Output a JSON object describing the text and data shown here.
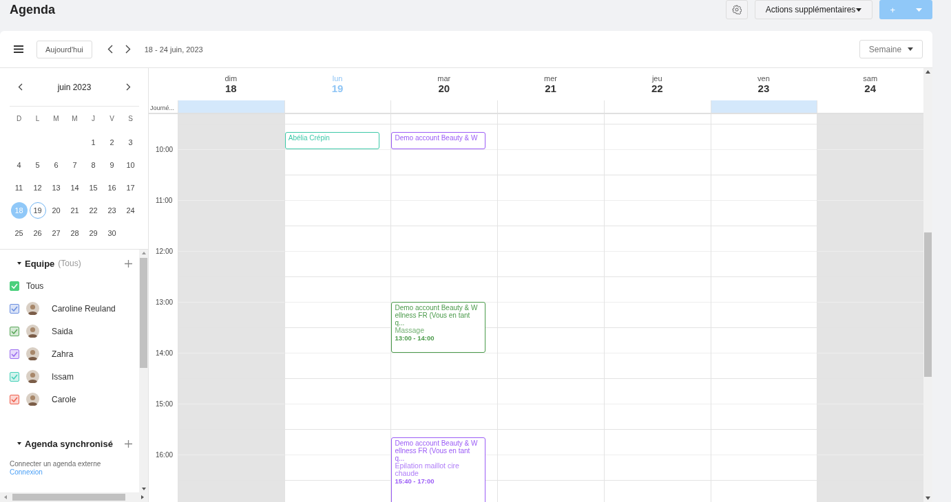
{
  "page_title": "Agenda",
  "header_actions": {
    "more_actions": "Actions supplémentaires",
    "add": "+"
  },
  "toolbar": {
    "today": "Aujourd'hui",
    "range": "18 - 24 juin, 2023",
    "view": "Semaine"
  },
  "mini_calendar": {
    "month": "juin 2023",
    "weekdays": [
      "D",
      "L",
      "M",
      "M",
      "J",
      "V",
      "S"
    ],
    "weeks": [
      [
        {
          "d": "1",
          "selected": false,
          "today": false
        },
        {
          "d": "2",
          "selected": false,
          "today": false
        },
        {
          "d": "3",
          "selected": false,
          "today": false
        }
      ],
      [
        {
          "d": "4",
          "selected": false,
          "today": false
        },
        {
          "d": "5",
          "selected": false,
          "today": false
        },
        {
          "d": "6",
          "selected": false,
          "today": false
        },
        {
          "d": "7",
          "selected": false,
          "today": false
        },
        {
          "d": "8",
          "selected": false,
          "today": false
        },
        {
          "d": "9",
          "selected": false,
          "today": false
        },
        {
          "d": "10",
          "selected": false,
          "today": false
        }
      ],
      [
        {
          "d": "11",
          "selected": false,
          "today": false
        },
        {
          "d": "12",
          "selected": false,
          "today": false
        },
        {
          "d": "13",
          "selected": false,
          "today": false
        },
        {
          "d": "14",
          "selected": false,
          "today": false
        },
        {
          "d": "15",
          "selected": false,
          "today": false
        },
        {
          "d": "16",
          "selected": false,
          "today": false
        },
        {
          "d": "17",
          "selected": false,
          "today": false
        }
      ],
      [
        {
          "d": "18",
          "selected": true,
          "today": false
        },
        {
          "d": "19",
          "selected": false,
          "today": true
        },
        {
          "d": "20",
          "selected": false,
          "today": false
        },
        {
          "d": "21",
          "selected": false,
          "today": false
        },
        {
          "d": "22",
          "selected": false,
          "today": false
        },
        {
          "d": "23",
          "selected": false,
          "today": false
        },
        {
          "d": "24",
          "selected": false,
          "today": false
        }
      ],
      [
        {
          "d": "25",
          "selected": false,
          "today": false
        },
        {
          "d": "26",
          "selected": false,
          "today": false
        },
        {
          "d": "27",
          "selected": false,
          "today": false
        },
        {
          "d": "28",
          "selected": false,
          "today": false
        },
        {
          "d": "29",
          "selected": false,
          "today": false
        },
        {
          "d": "30",
          "selected": false,
          "today": false
        }
      ]
    ]
  },
  "team": {
    "title": "Equipe",
    "filter": "(Tous)",
    "expanded": true,
    "members": [
      {
        "name": "Tous",
        "kind": "all",
        "color": "#4cd07d",
        "checked": true
      },
      {
        "name": "Caroline Reuland",
        "kind": "person",
        "color": "#6b8fe0",
        "checked": true
      },
      {
        "name": "Saida",
        "kind": "person",
        "color": "#5aa85a",
        "checked": true
      },
      {
        "name": "Zahra",
        "kind": "person",
        "color": "#9b6cf0",
        "checked": true
      },
      {
        "name": "Issam",
        "kind": "person",
        "color": "#45d0b8",
        "checked": true
      },
      {
        "name": "Carole",
        "kind": "person",
        "color": "#f0604e",
        "checked": true
      }
    ]
  },
  "synced": {
    "title": "Agenda synchronisé",
    "expanded": true,
    "text": "Connecter un agenda externe",
    "link": "Connexion"
  },
  "week": {
    "all_day_label": "Journé...",
    "days": [
      {
        "dow": "dim",
        "date": "18",
        "today": false,
        "weekend": true,
        "all_day_highlight": true
      },
      {
        "dow": "lun",
        "date": "19",
        "today": true,
        "weekend": false,
        "all_day_highlight": false
      },
      {
        "dow": "mar",
        "date": "20",
        "today": false,
        "weekend": false,
        "all_day_highlight": false
      },
      {
        "dow": "mer",
        "date": "21",
        "today": false,
        "weekend": false,
        "all_day_highlight": false
      },
      {
        "dow": "jeu",
        "date": "22",
        "today": false,
        "weekend": false,
        "all_day_highlight": false
      },
      {
        "dow": "ven",
        "date": "23",
        "today": false,
        "weekend": false,
        "all_day_highlight": true
      },
      {
        "dow": "sam",
        "date": "24",
        "today": false,
        "weekend": true,
        "all_day_highlight": false
      }
    ],
    "hours": [
      "10:00",
      "11:00",
      "12:00",
      "13:00",
      "14:00",
      "15:00",
      "16:00"
    ],
    "events": [
      {
        "title": "Abélia Crépin",
        "color": "#3cc9a8"
      },
      {
        "title": "Demo account Beauty & W",
        "color": "#9b5cf6"
      },
      {
        "title": "Demo account Beauty & Wellness FR (Vous en tant q...",
        "service": "Massage",
        "time": "13:00 - 14:00",
        "color": "#4a9a4a"
      },
      {
        "title": "Demo account Beauty & Wellness FR (Vous en tant q...",
        "service": "Epilation maillot cire chaude",
        "time": "15:40 - 17:00",
        "color": "#9b5cf6"
      }
    ]
  }
}
